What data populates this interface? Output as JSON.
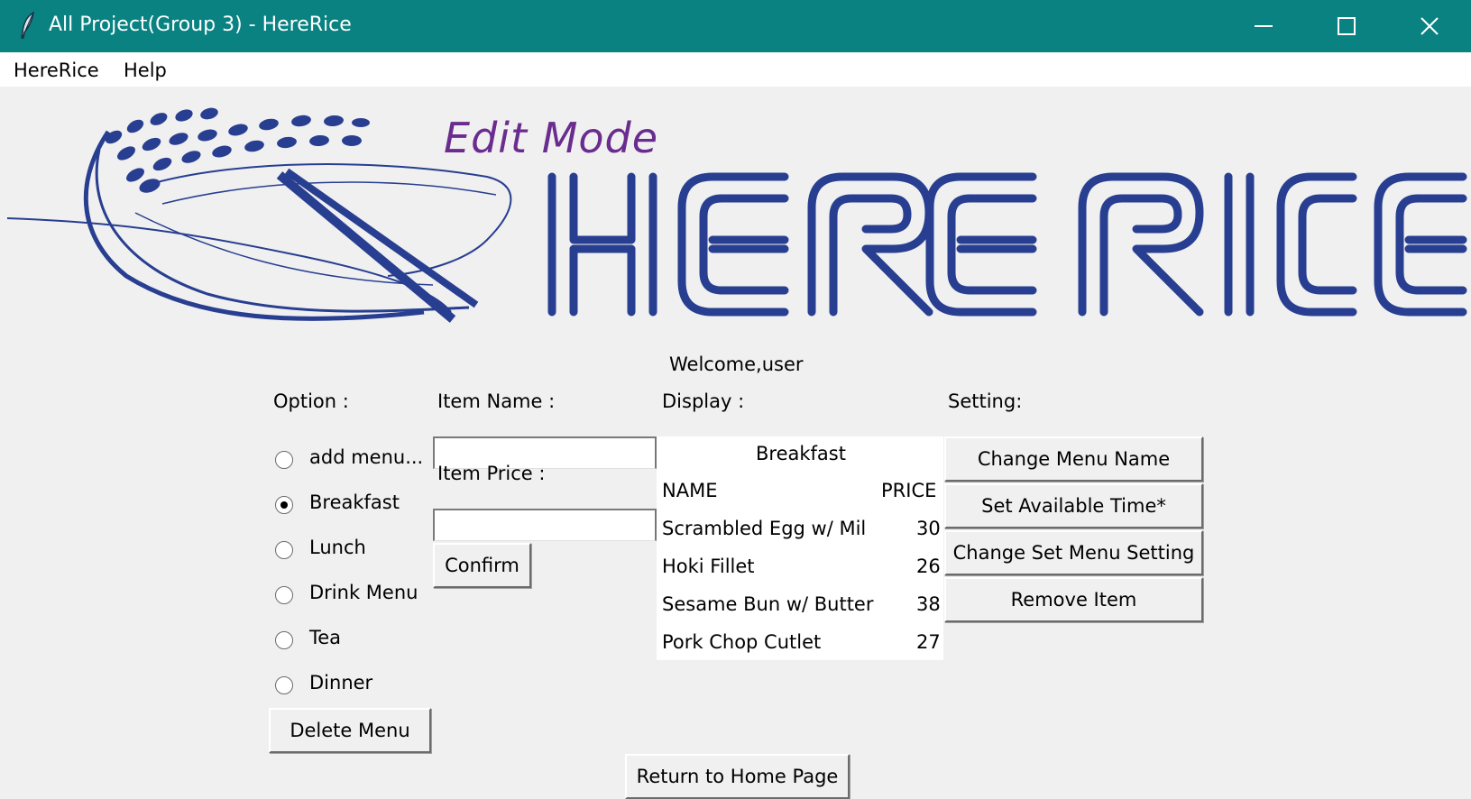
{
  "window": {
    "title": "All Project(Group 3) - HereRice",
    "app_icon": "feather-icon",
    "controls": [
      "minimize-icon",
      "maximize-icon",
      "close-icon"
    ]
  },
  "menubar": {
    "items": [
      "HereRice",
      "Help"
    ]
  },
  "header": {
    "mode_label": "Edit Mode",
    "logo_text": "HERE RICE",
    "brand_color": "#283e91",
    "mode_color": "#6a2c8e"
  },
  "welcome": "Welcome,user",
  "option": {
    "label": "Option :",
    "choices": [
      {
        "label": "add menu...",
        "checked": false
      },
      {
        "label": "Breakfast",
        "checked": true
      },
      {
        "label": "Lunch",
        "checked": false
      },
      {
        "label": "Drink Menu",
        "checked": false
      },
      {
        "label": "Tea",
        "checked": false
      },
      {
        "label": "Dinner",
        "checked": false
      }
    ],
    "delete_button": "Delete Menu"
  },
  "item_form": {
    "name_label": "Item Name :",
    "name_value": "",
    "price_label": "Item Price :",
    "price_value": "",
    "confirm_button": "Confirm"
  },
  "display": {
    "label": "Display :",
    "menu_title": "Breakfast",
    "columns": [
      "NAME",
      "PRICE"
    ],
    "rows": [
      {
        "name": "Scrambled Egg w/ Mil",
        "price": "30"
      },
      {
        "name": "Hoki Fillet",
        "price": "26"
      },
      {
        "name": "Sesame Bun w/ Butter",
        "price": "38"
      },
      {
        "name": "Pork Chop Cutlet",
        "price": "27"
      }
    ]
  },
  "setting": {
    "label": "Setting:",
    "buttons": [
      "Change Menu Name",
      "Set Available Time*",
      "Change Set Menu Setting",
      "Remove Item"
    ]
  },
  "footer": {
    "return_button": "Return to Home Page"
  },
  "colors": {
    "titlebar": "#0a8282",
    "background": "#f0f0f0"
  }
}
